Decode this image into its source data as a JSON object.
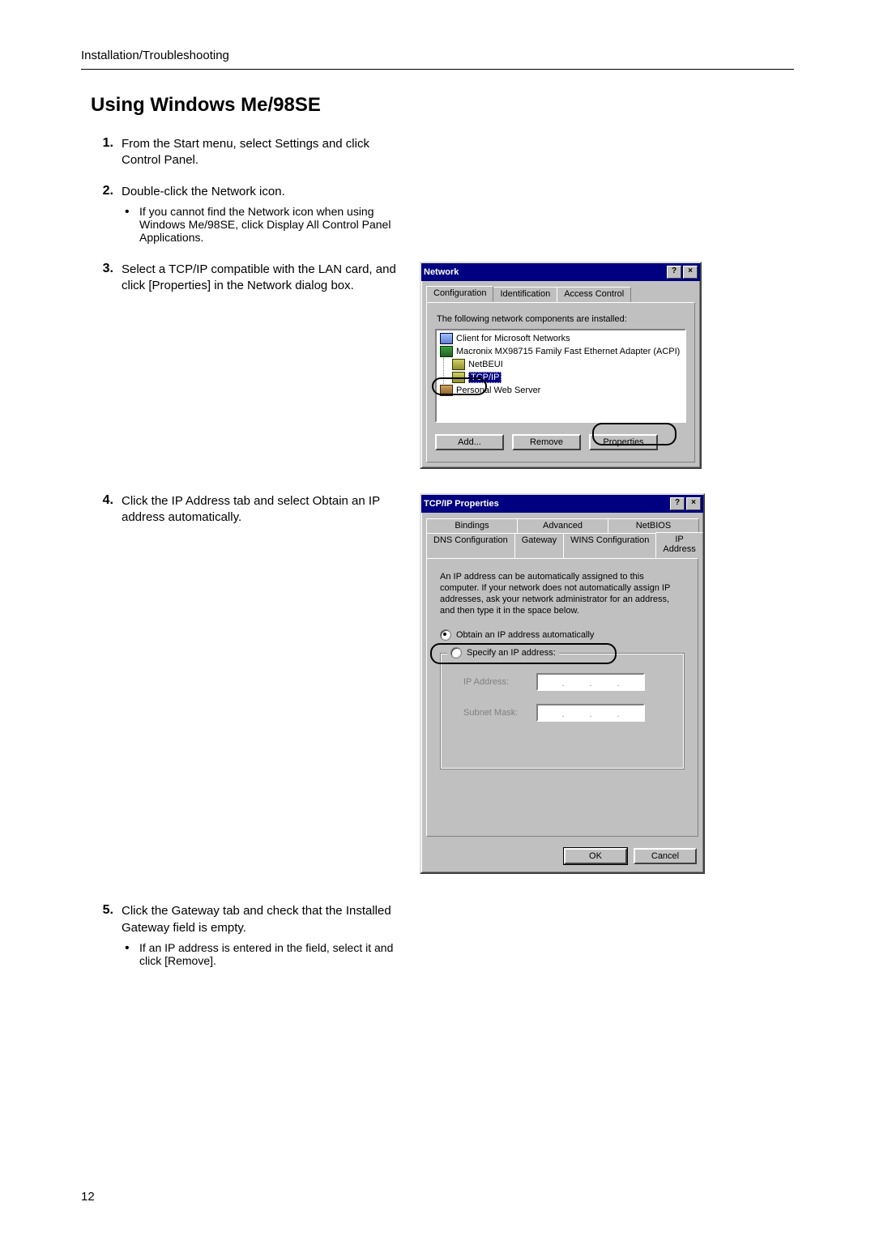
{
  "doc": {
    "running_head": "Installation/Troubleshooting",
    "section_title": "Using Windows Me/98SE",
    "page_number": "12"
  },
  "steps": {
    "s1": {
      "num": "1.",
      "text": "From the Start menu, select Settings and click Control Panel."
    },
    "s2": {
      "num": "2.",
      "text": "Double-click the Network icon.",
      "bullet_a": "If you cannot find the Network icon when using Windows Me/98SE, click Display All Control Panel Applications."
    },
    "s3": {
      "num": "3.",
      "text": "Select a TCP/IP compatible with the LAN card, and click [Properties] in the Network dialog box."
    },
    "s4": {
      "num": "4.",
      "text": "Click the IP Address tab and select Obtain an IP address automatically."
    },
    "s5": {
      "num": "5.",
      "text": "Click the Gateway tab and check that the Installed Gateway field is empty.",
      "bullet_a": "If an IP address is entered in the field, select it and click [Remove]."
    }
  },
  "network_dialog": {
    "title": "Network",
    "help_glyph": "?",
    "close_glyph": "×",
    "tabs": {
      "configuration": "Configuration",
      "identification": "Identification",
      "access": "Access Control"
    },
    "label_components": "The following network components are installed:",
    "items": {
      "client": "Client for Microsoft Networks",
      "adapter": "Macronix MX98715 Family Fast Ethernet Adapter (ACPI)",
      "netbeui": "NetBEUI",
      "tcpip": "TCP/IP",
      "pws": "Personal Web Server"
    },
    "buttons": {
      "add": "Add...",
      "remove": "Remove",
      "properties": "Properties"
    },
    "accel": {
      "add": "A",
      "remove": "R",
      "properties": "P",
      "netbeui": "N",
      "components": "n"
    }
  },
  "tcpip_dialog": {
    "title": "TCP/IP Properties",
    "help_glyph": "?",
    "close_glyph": "×",
    "tabs_row1": {
      "bindings": "Bindings",
      "advanced": "Advanced",
      "netbios": "NetBIOS"
    },
    "tabs_row2": {
      "dns": "DNS Configuration",
      "gateway": "Gateway",
      "wins": "WINS Configuration",
      "ip": "IP Address"
    },
    "desc": "An IP address can be automatically assigned to this computer. If your network does not automatically assign IP addresses, ask your network administrator for an address, and then type it in the space below.",
    "radio_auto": "Obtain an IP address automatically",
    "radio_spec": "Specify an IP address:",
    "lbl_ip": "IP Address:",
    "lbl_mask": "Subnet Mask:",
    "buttons": {
      "ok": "OK",
      "cancel": "Cancel"
    },
    "accel": {
      "auto": "O",
      "spec": "S",
      "ip": "I",
      "mask": "u"
    }
  }
}
